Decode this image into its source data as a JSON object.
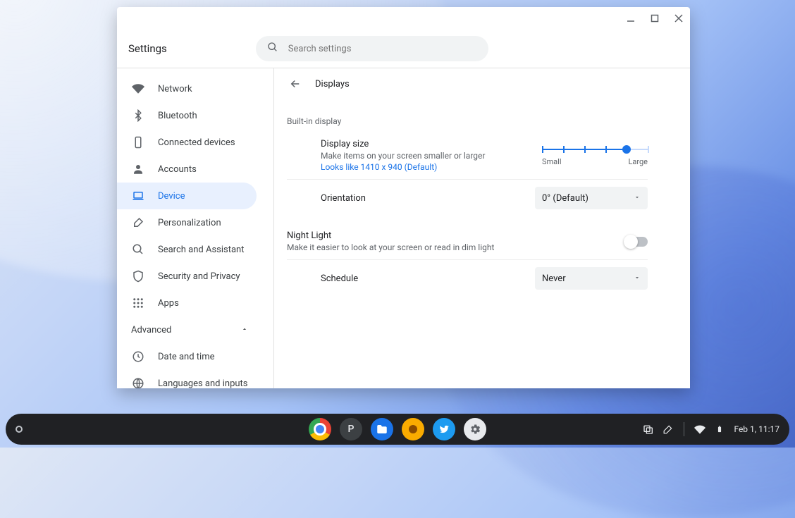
{
  "window": {
    "app_title": "Settings",
    "search_placeholder": "Search settings"
  },
  "sidebar": {
    "items": [
      {
        "label": "Network",
        "icon": "wifi"
      },
      {
        "label": "Bluetooth",
        "icon": "bluetooth"
      },
      {
        "label": "Connected devices",
        "icon": "phone"
      },
      {
        "label": "Accounts",
        "icon": "person"
      },
      {
        "label": "Device",
        "icon": "laptop",
        "active": true
      },
      {
        "label": "Personalization",
        "icon": "brush"
      },
      {
        "label": "Search and Assistant",
        "icon": "search"
      },
      {
        "label": "Security and Privacy",
        "icon": "shield"
      },
      {
        "label": "Apps",
        "icon": "apps"
      }
    ],
    "advanced_label": "Advanced",
    "advanced_items": [
      {
        "label": "Date and time",
        "icon": "clock"
      },
      {
        "label": "Languages and inputs",
        "icon": "globe"
      }
    ]
  },
  "page": {
    "title": "Displays",
    "builtin_section": "Built-in display",
    "display_size": {
      "title": "Display size",
      "sub": "Make items on your screen smaller or larger",
      "looks_like": "Looks like 1410 x 940 (Default)",
      "small_label": "Small",
      "large_label": "Large",
      "ticks": 6,
      "value_index": 4
    },
    "orientation": {
      "title": "Orientation",
      "value": "0° (Default)"
    },
    "night_light": {
      "title": "Night Light",
      "sub": "Make it easier to look at your screen or read in dim light",
      "enabled": false
    },
    "schedule": {
      "title": "Schedule",
      "value": "Never"
    }
  },
  "shelf": {
    "apps": [
      {
        "name": "chrome"
      },
      {
        "name": "P"
      },
      {
        "name": "files"
      },
      {
        "name": "scratch"
      },
      {
        "name": "twitter"
      },
      {
        "name": "settings"
      }
    ],
    "status_time": "Feb 1, 11:17"
  }
}
